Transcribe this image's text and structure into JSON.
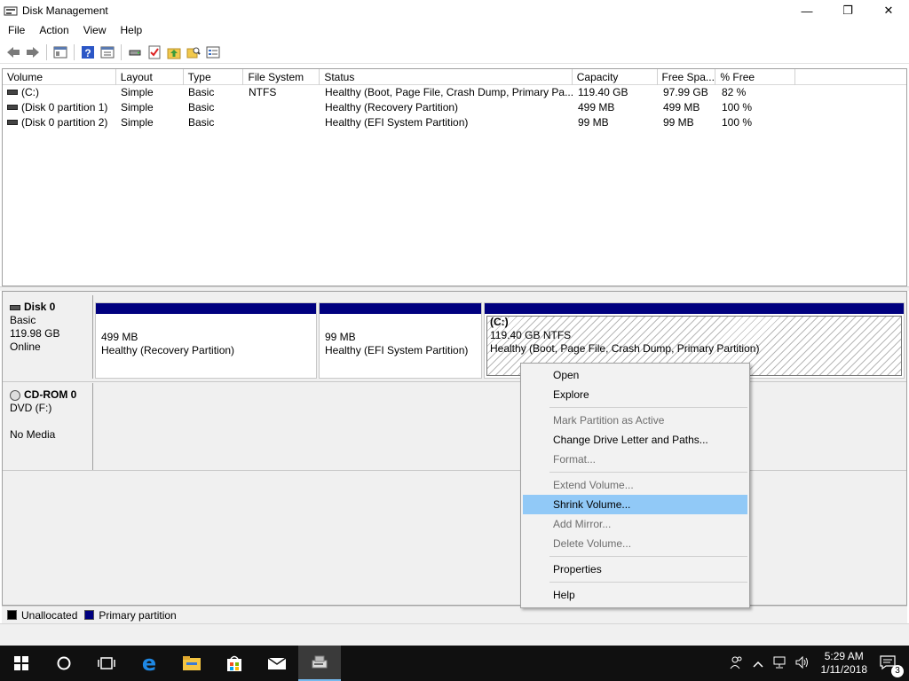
{
  "window": {
    "title": "Disk Management",
    "minimize": "—",
    "maximize": "❐",
    "close": "✕"
  },
  "menubar": [
    "File",
    "Action",
    "View",
    "Help"
  ],
  "volume_list": {
    "columns": [
      "Volume",
      "Layout",
      "Type",
      "File System",
      "Status",
      "Capacity",
      "Free Spa...",
      "% Free"
    ],
    "rows": [
      [
        "(C:)",
        "Simple",
        "Basic",
        "NTFS",
        "Healthy (Boot, Page File, Crash Dump, Primary Pa...",
        "119.40 GB",
        "97.99 GB",
        "82 %"
      ],
      [
        "(Disk 0 partition 1)",
        "Simple",
        "Basic",
        "",
        "Healthy (Recovery Partition)",
        "499 MB",
        "499 MB",
        "100 %"
      ],
      [
        "(Disk 0 partition 2)",
        "Simple",
        "Basic",
        "",
        "Healthy (EFI System Partition)",
        "99 MB",
        "99 MB",
        "100 %"
      ]
    ]
  },
  "disks": {
    "disk0": {
      "name": "Disk 0",
      "type": "Basic",
      "size": "119.98 GB",
      "state": "Online"
    },
    "cdrom0": {
      "name": "CD-ROM 0",
      "type": "DVD (F:)",
      "media": "No Media"
    }
  },
  "partitions": [
    {
      "label": "",
      "size": "499 MB",
      "status": "Healthy (Recovery Partition)"
    },
    {
      "label": "",
      "size": "99 MB",
      "status": "Healthy (EFI System Partition)"
    },
    {
      "label": "(C:)",
      "size": "119.40 GB NTFS",
      "status": "Healthy (Boot, Page File, Crash Dump, Primary Partition)"
    }
  ],
  "legend": {
    "unallocated": "Unallocated",
    "primary": "Primary partition",
    "unallocated_color": "#000000",
    "primary_color": "#00007f"
  },
  "context_menu": {
    "open": "Open",
    "explore": "Explore",
    "mark_active": "Mark Partition as Active",
    "change_letter": "Change Drive Letter and Paths...",
    "format": "Format...",
    "extend": "Extend Volume...",
    "shrink": "Shrink Volume...",
    "add_mirror": "Add Mirror...",
    "delete": "Delete Volume...",
    "properties": "Properties",
    "help": "Help"
  },
  "taskbar": {
    "time": "5:29 AM",
    "date": "1/11/2018",
    "notifications": "3"
  },
  "colors": {
    "accent": "#91c9f7",
    "primary_partition": "#00007f"
  }
}
